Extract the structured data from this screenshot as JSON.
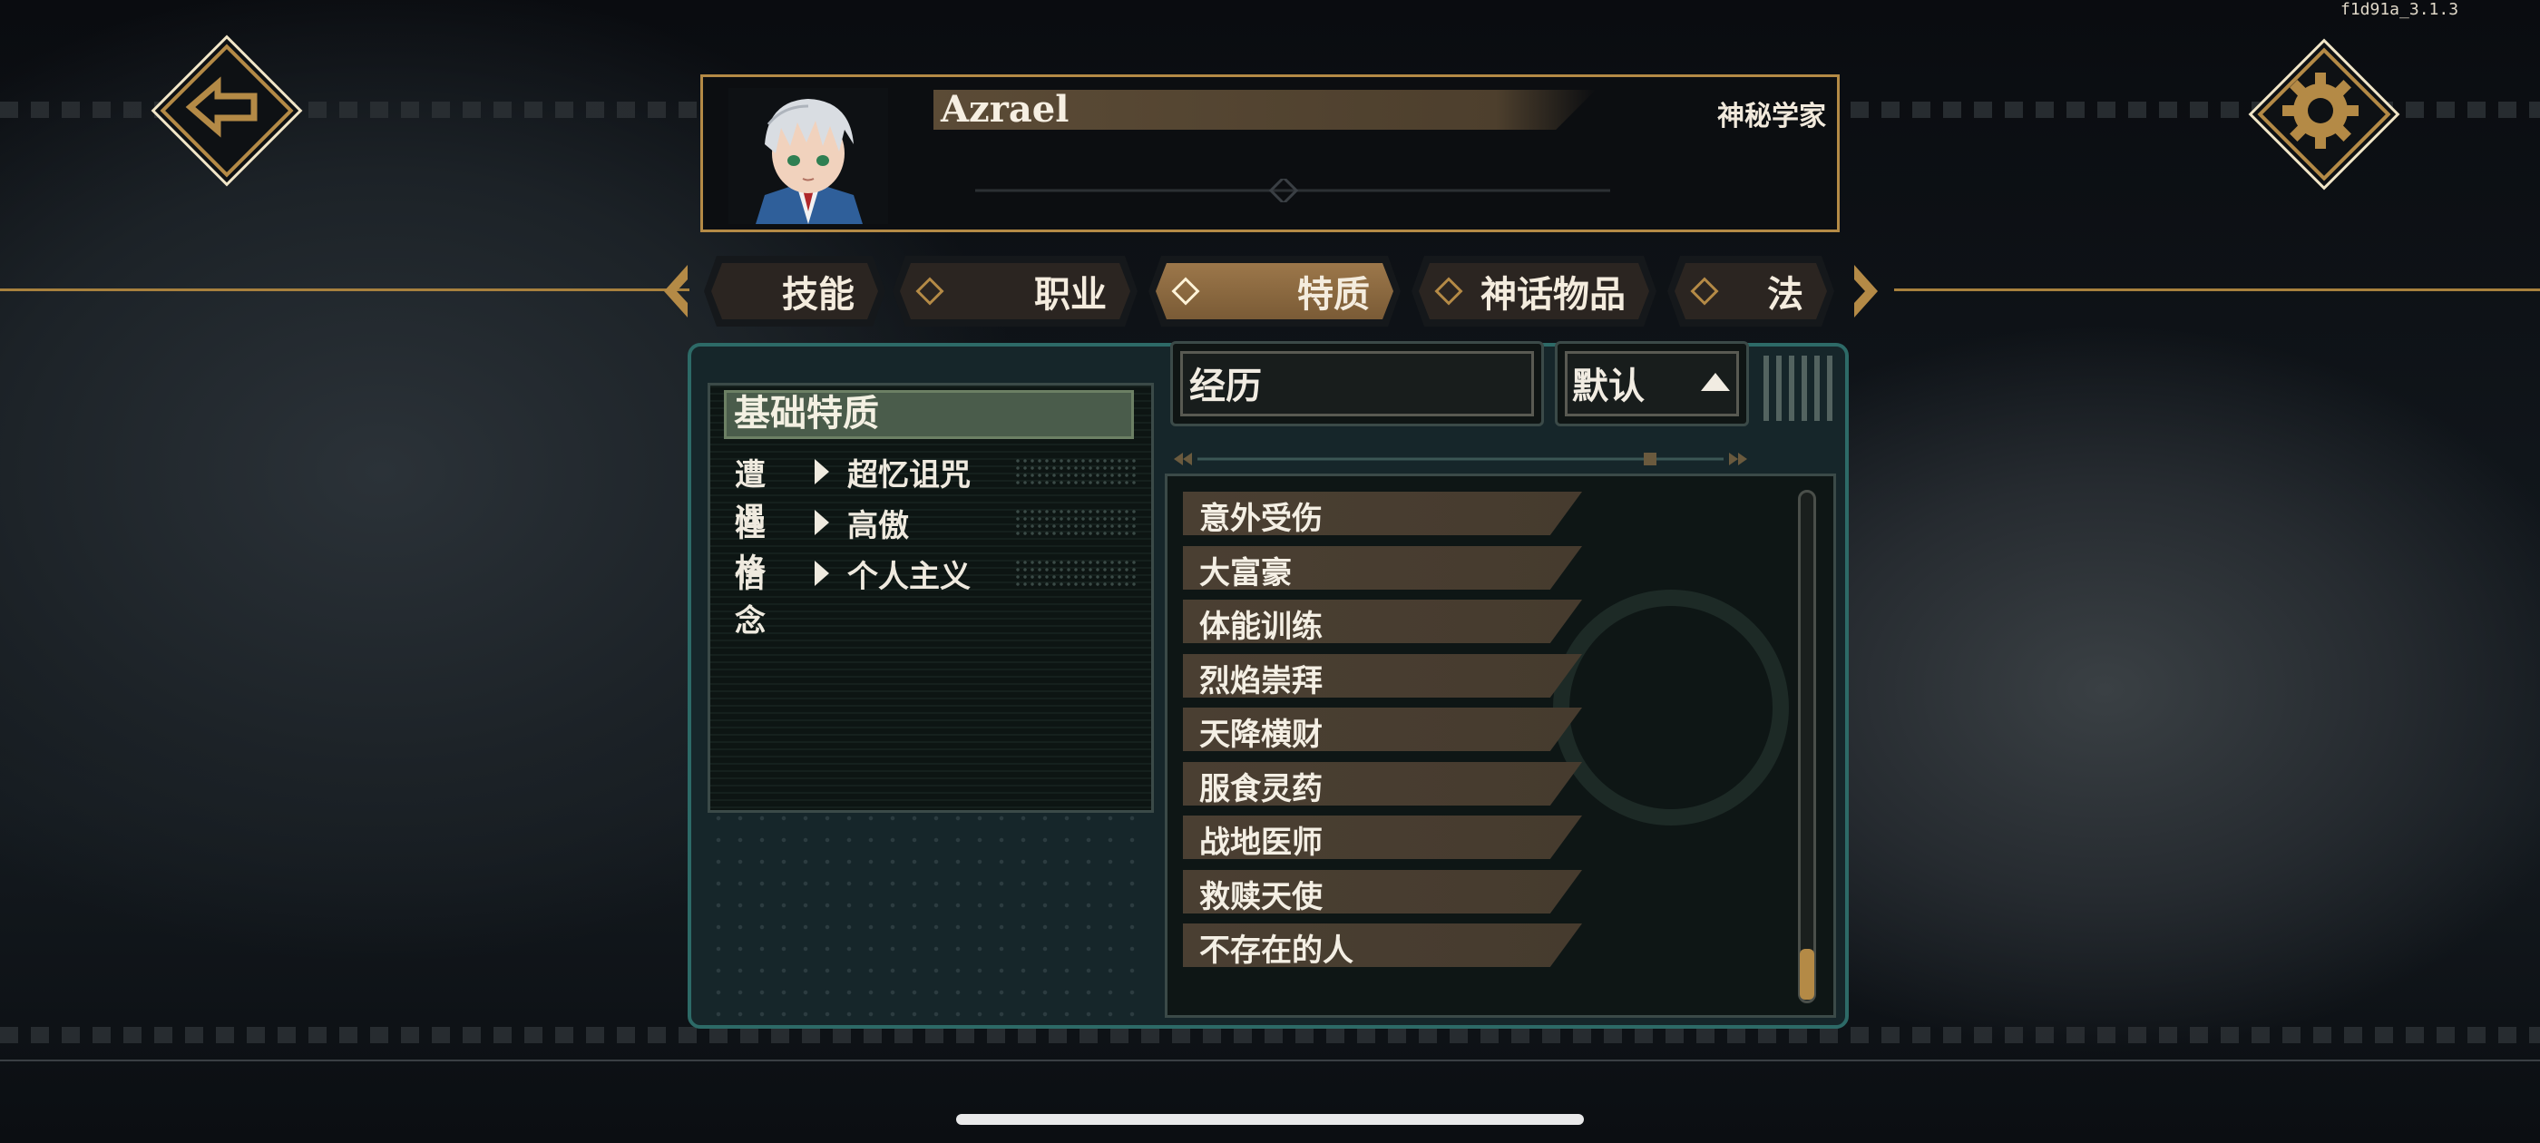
{
  "version": "f1d91a_3.1.3",
  "character": {
    "name": "Azrael",
    "class": "神秘学家"
  },
  "tabs": [
    {
      "label": "技能",
      "active": false
    },
    {
      "label": "职业",
      "active": false
    },
    {
      "label": "特质",
      "active": true
    },
    {
      "label": "神话物品",
      "active": false
    },
    {
      "label": "法",
      "active": false
    }
  ],
  "basic_traits": {
    "title": "基础特质",
    "rows": [
      {
        "key": "遭遇",
        "value": "超忆诅咒"
      },
      {
        "key": "性格",
        "value": "高傲"
      },
      {
        "key": "信念",
        "value": "个人主义"
      }
    ]
  },
  "filter": {
    "search_value": "经历",
    "sort_value": "默认"
  },
  "trait_list": [
    "意外受伤",
    "大富豪",
    "体能训练",
    "烈焰崇拜",
    "天降横财",
    "服食灵药",
    "战地医师",
    "救赎天使",
    "不存在的人"
  ],
  "colors": {
    "gold": "#b48a46",
    "panel_teal": "#2d6a67",
    "active_tab": "#9c774a",
    "section_green": "#4a5c4b"
  },
  "icons": {
    "back": "back-arrow-icon",
    "settings": "gear-icon"
  }
}
